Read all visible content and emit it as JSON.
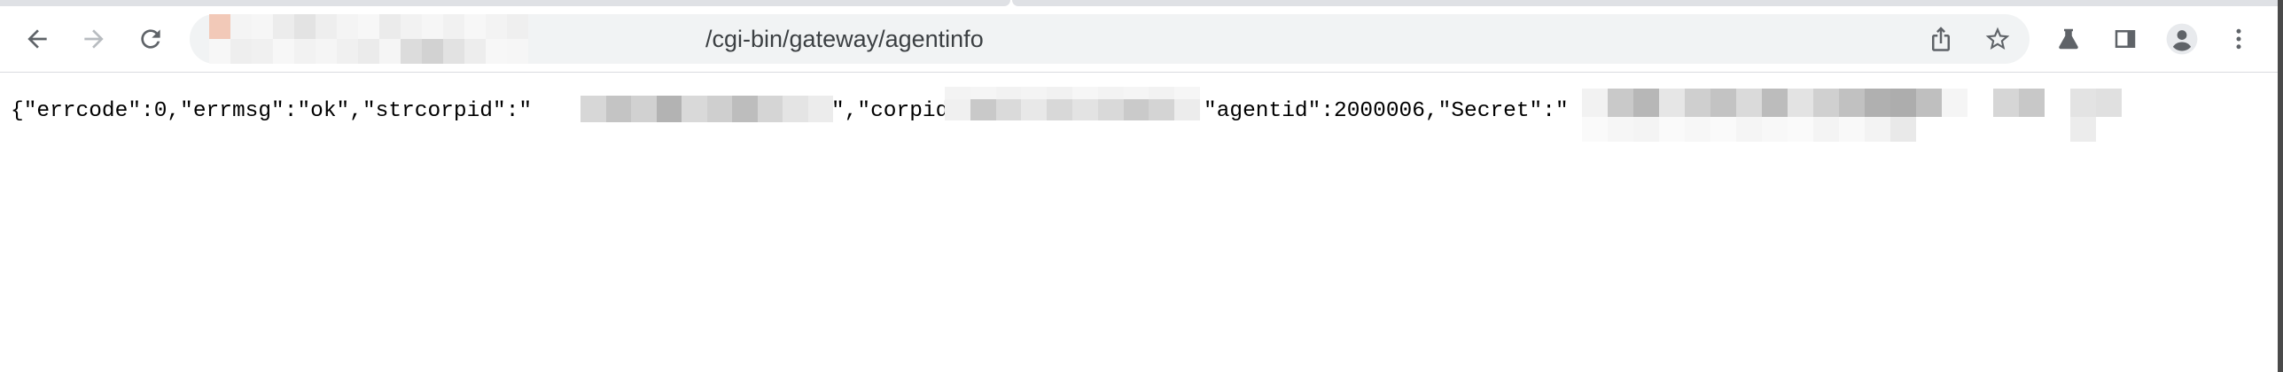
{
  "browser": {
    "nav": {
      "back_icon": "arrow-left-icon",
      "forward_icon": "arrow-right-icon",
      "reload_icon": "reload-icon"
    },
    "omnibox": {
      "url_path": "/cgi-bin/gateway/agentinfo"
    },
    "toolbar_icons": [
      "share-icon",
      "star-icon",
      "flask-icon",
      "side-panel-icon",
      "profile-icon",
      "kebab-menu-icon"
    ],
    "colors": {
      "toolbar_bg": "#ffffff",
      "omnibox_bg": "#f1f3f4",
      "icon": "#5f6368",
      "icon_disabled": "#b8bcc0"
    }
  },
  "response": {
    "seg1": "{\"errcode\":0,\"errmsg\":\"ok\",\"strcorpid\":\"",
    "seg2": "\",\"corpid\"",
    "seg3": "\"agentid\":2000006,\"Secret\":\""
  }
}
